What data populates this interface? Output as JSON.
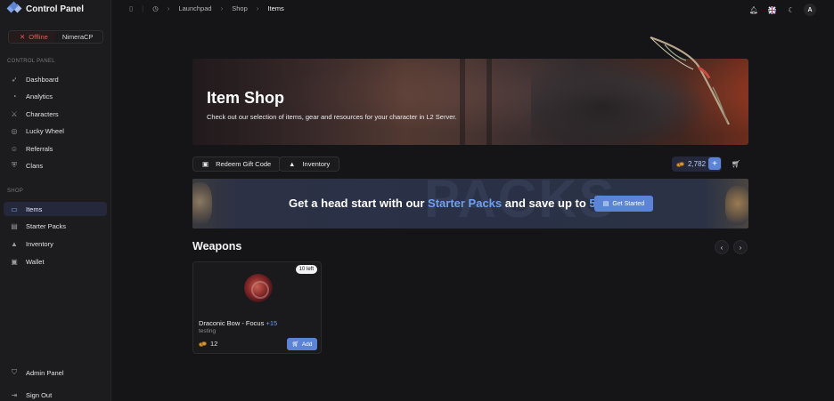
{
  "app": {
    "title": "Control Panel"
  },
  "status": {
    "state": "Offline",
    "server": "NimeraCP"
  },
  "sidebar": {
    "control_label": "CONTROL PANEL",
    "control_items": [
      {
        "label": "Dashboard",
        "icon": "rocket-icon"
      },
      {
        "label": "Analytics",
        "icon": "chart-icon"
      },
      {
        "label": "Characters",
        "icon": "characters-icon"
      },
      {
        "label": "Lucky Wheel",
        "icon": "wheel-icon"
      },
      {
        "label": "Referrals",
        "icon": "referrals-icon"
      },
      {
        "label": "Clans",
        "icon": "shield-icon"
      }
    ],
    "shop_label": "SHOP",
    "shop_items": [
      {
        "label": "Items",
        "icon": "items-icon",
        "active": true
      },
      {
        "label": "Starter Packs",
        "icon": "pack-icon"
      },
      {
        "label": "Inventory",
        "icon": "bag-icon"
      },
      {
        "label": "Wallet",
        "icon": "wallet-icon"
      }
    ],
    "admin_label": "Admin Panel",
    "signout_label": "Sign Out"
  },
  "breadcrumb": [
    "Launchpad",
    "Shop",
    "Items"
  ],
  "user": {
    "initial": "A"
  },
  "hero": {
    "title": "Item Shop",
    "description": "Check out our selection of items, gear and resources for your character in L2 Server."
  },
  "actions": {
    "redeem_label": "Redeem Gift Code",
    "inventory_label": "Inventory",
    "balance": "2,782",
    "add_funds_label": "+"
  },
  "promo": {
    "bg_word": "PACKS",
    "text_1": "Get a head start with our ",
    "highlight_1": "Starter Packs",
    "text_2": " and save up to ",
    "highlight_2": "50%!",
    "cta_label": "Get Started"
  },
  "weapons": {
    "title": "Weapons",
    "items": [
      {
        "name": "Draconic Bow - Focus",
        "enchant": "+15",
        "subtitle": "testing",
        "stock": "10 left",
        "price": "12",
        "add_label": "Add"
      }
    ]
  },
  "colors": {
    "accent": "#5b84d6",
    "accent_text": "#6f9ff0",
    "offline": "#e05a55",
    "background": "#151517",
    "sidebar": "#1c1c1f"
  }
}
